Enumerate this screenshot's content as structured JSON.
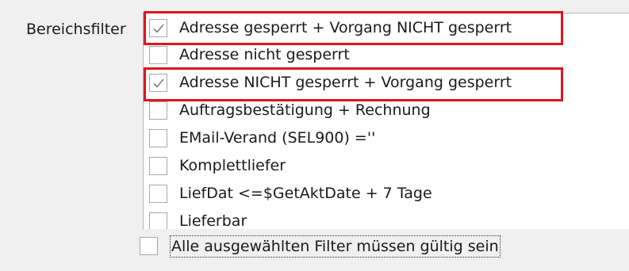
{
  "filter": {
    "label": "Bereichsfilter",
    "items": [
      {
        "label": "Adresse gesperrt + Vorgang NICHT gesperrt",
        "checked": true,
        "highlighted": true
      },
      {
        "label": "Adresse nicht gesperrt",
        "checked": false,
        "highlighted": false
      },
      {
        "label": "Adresse NICHT gesperrt + Vorgang gesperrt",
        "checked": true,
        "highlighted": true
      },
      {
        "label": "Auftragsbestätigung + Rechnung",
        "checked": false,
        "highlighted": false
      },
      {
        "label": "EMail-Verand (SEL900) =''",
        "checked": false,
        "highlighted": false
      },
      {
        "label": "Komplettliefer",
        "checked": false,
        "highlighted": false
      },
      {
        "label": "LiefDat <=$GetAktDate + 7 Tage",
        "checked": false,
        "highlighted": false
      },
      {
        "label": "Lieferbar",
        "checked": false,
        "highlighted": false
      }
    ],
    "all_valid_label": "Alle ausgewählten Filter müssen gültig sein",
    "all_valid_checked": false,
    "highlight_color": "#e0141e"
  }
}
